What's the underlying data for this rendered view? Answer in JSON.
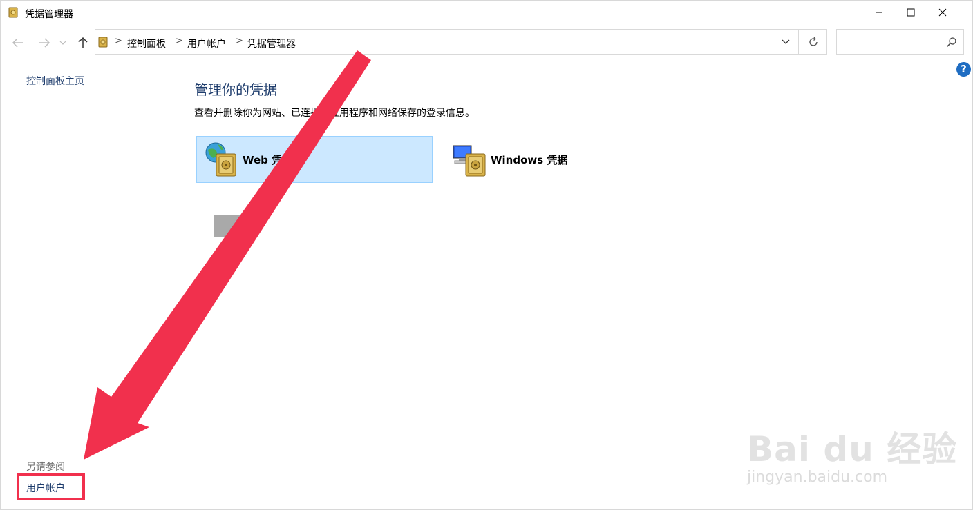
{
  "window": {
    "title": "凭据管理器"
  },
  "address": {
    "breadcrumbs": [
      "控制面板",
      "用户帐户",
      "凭据管理器"
    ],
    "separator": ">"
  },
  "search": {
    "value": "",
    "placeholder": ""
  },
  "help": {
    "label": "?"
  },
  "left_pane": {
    "home_link": "控制面板主页",
    "see_also_heading": "另请参阅",
    "see_also_link": "用户帐户"
  },
  "main": {
    "title": "管理你的凭据",
    "description": "查看并删除你为网站、已连接的应用程序和网络保存的登录信息。",
    "tiles": [
      {
        "label": "Web 凭据",
        "icon": "globe-vault-icon",
        "selected": true
      },
      {
        "label": "Windows 凭据",
        "icon": "computer-vault-icon",
        "selected": false
      }
    ]
  },
  "watermark": {
    "brand": "Bai du 经验",
    "url": "jingyan.baidu.com"
  },
  "colors": {
    "accent_link": "#1e3c6c",
    "selected_tile_bg": "#cce8ff",
    "selected_tile_border": "#99d1ff",
    "annotation_red": "#f1304d",
    "help_blue": "#1f6dc2"
  }
}
